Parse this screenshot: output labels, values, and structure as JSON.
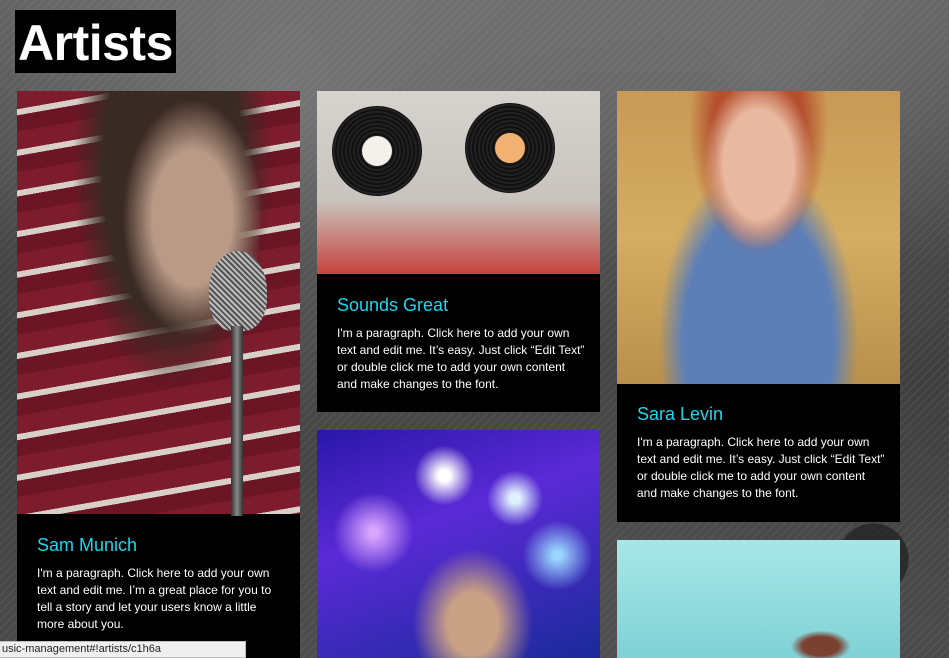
{
  "page": {
    "title": "Artists"
  },
  "cards": [
    {
      "name": "Sam Munich",
      "description": "I'm a paragraph. Click here to add your own text and edit me. I’m a great place for you to tell a story and let your users know a little more about you.",
      "photo_icon": "singer-with-microphone-photo"
    },
    {
      "name": "Sounds Great",
      "description": "I'm a paragraph. Click here to add your own text and edit me. It’s easy. Just click “Edit Text” or double click me to add your own content and make changes to the font.",
      "photo_icon": "vinyl-records-photo"
    },
    {
      "name": "",
      "description": "",
      "photo_icon": "dj-with-lights-photo"
    },
    {
      "name": "Sara Levin",
      "description": "I'm a paragraph. Click here to add your own text and edit me. It’s easy. Just click “Edit Text” or double click me to add your own content and make changes to the font.",
      "photo_icon": "woman-portrait-photo"
    },
    {
      "name": "",
      "description": "",
      "photo_icon": "woman-outdoor-photo"
    }
  ],
  "status_bar": {
    "url": "usic-management#!artists/c1h6a"
  },
  "colors": {
    "accent": "#1ad7ef",
    "card_bg": "#000000",
    "title_bg": "#000000"
  }
}
